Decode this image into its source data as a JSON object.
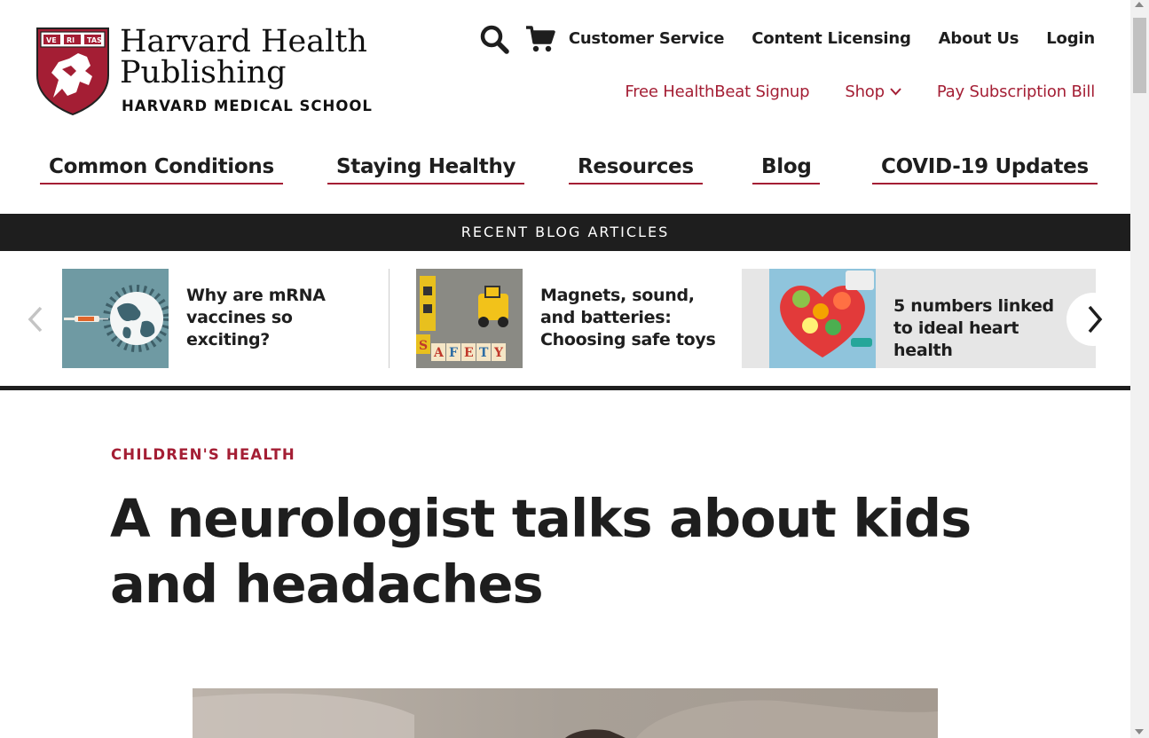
{
  "logo": {
    "line1": "Harvard Health",
    "line2": "Publishing",
    "subtitle": "HARVARD MEDICAL SCHOOL",
    "shield_text": "VE RI TAS"
  },
  "utility_nav": [
    "Customer Service",
    "Content Licensing",
    "About Us",
    "Login"
  ],
  "sub_nav": {
    "signup": "Free HealthBeat Signup",
    "shop": "Shop",
    "pay": "Pay Subscription Bill"
  },
  "main_nav": [
    "Common Conditions",
    "Staying Healthy",
    "Resources",
    "Blog",
    "COVID-19 Updates"
  ],
  "recent_blog": {
    "heading": "RECENT BLOG ARTICLES",
    "cards": [
      {
        "title": "Why are mRNA vaccines so exciting?"
      },
      {
        "title": "Magnets, sound, and batteries: Choosing safe toys"
      },
      {
        "title": "5 numbers linked to ideal heart health"
      }
    ],
    "safety_letters": [
      "S",
      "A",
      "F",
      "E",
      "T",
      "Y"
    ]
  },
  "article": {
    "category": "CHILDREN'S HEALTH",
    "headline": "A neurologist talks about kids and headaches"
  },
  "colors": {
    "accent": "#a41e34",
    "dark": "#1e1e1e",
    "shield": "#a41e34"
  },
  "icons": [
    "search-icon",
    "cart-icon",
    "chevron-down-icon",
    "chevron-left-icon",
    "chevron-right-icon"
  ]
}
